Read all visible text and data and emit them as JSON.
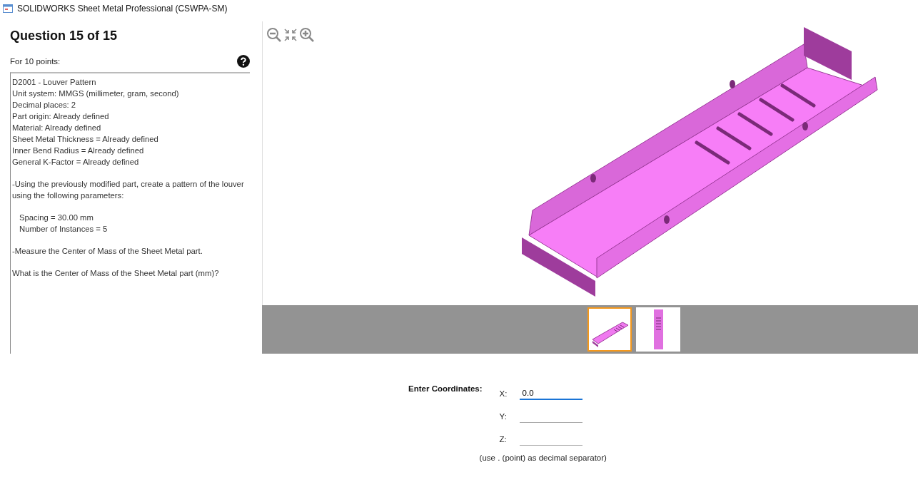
{
  "window": {
    "title": "SOLIDWORKS Sheet Metal Professional (CSWPA-SM)"
  },
  "question": {
    "heading": "Question 15 of 15",
    "points": "For 10 points:",
    "blocks": [
      {
        "indented": false,
        "lines": [
          "D2001 - Louver Pattern",
          "Unit system: MMGS (millimeter, gram, second)",
          "Decimal places: 2",
          "Part origin: Already defined",
          "Material: Already defined",
          "Sheet Metal Thickness = Already defined",
          "Inner Bend Radius = Already defined",
          "General K-Factor = Already defined"
        ]
      },
      {
        "indented": false,
        "lines": [
          "-Using the previously modified part, create a pattern of the louver using the following parameters:"
        ]
      },
      {
        "indented": true,
        "lines": [
          "Spacing = 30.00 mm",
          "Number of Instances = 5"
        ]
      },
      {
        "indented": false,
        "lines": [
          "-Measure the Center of Mass of the Sheet Metal part."
        ]
      },
      {
        "indented": false,
        "lines": [
          "What is the Center of Mass of the Sheet Metal part (mm)?"
        ]
      }
    ]
  },
  "viewer": {
    "thumbnails": [
      {
        "kind": "iso",
        "selected": true
      },
      {
        "kind": "top",
        "selected": false
      }
    ]
  },
  "answer": {
    "label": "Enter Coordinates:",
    "fields": [
      {
        "label": "X:",
        "value": "0.0",
        "focused": true
      },
      {
        "label": "Y:",
        "focused": false
      },
      {
        "label": "Z:",
        "focused": false
      }
    ],
    "hint": "(use . (point) as decimal separator)"
  }
}
